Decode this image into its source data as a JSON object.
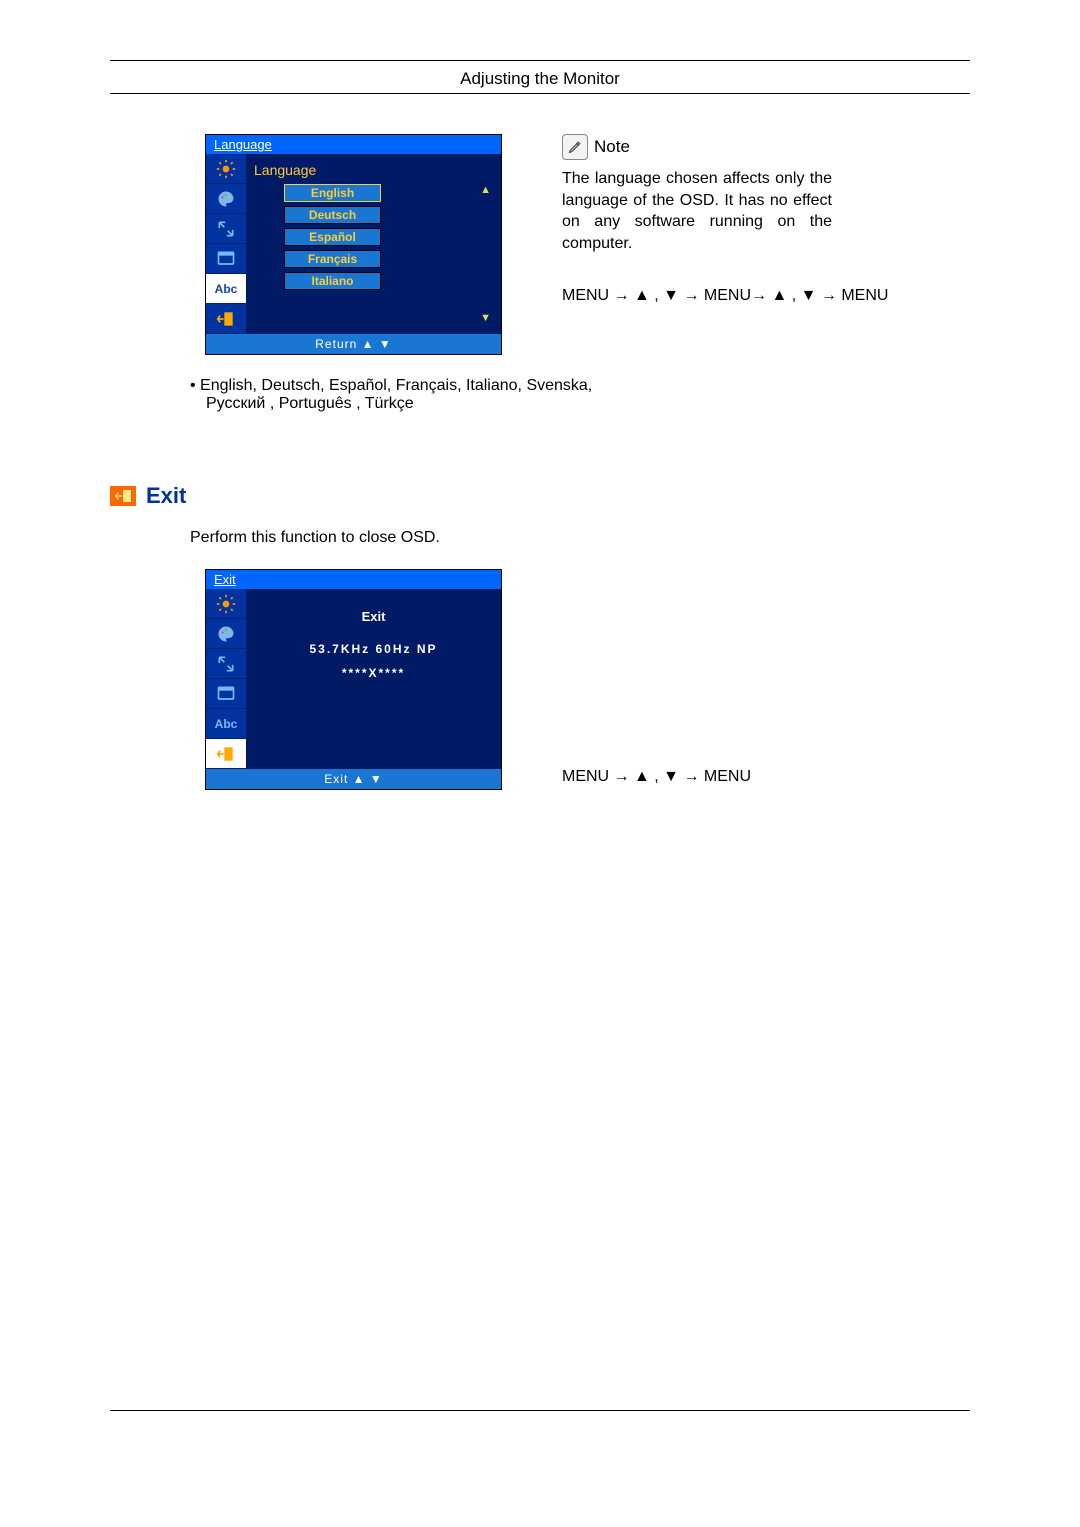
{
  "running_head": "Adjusting the Monitor",
  "osd1": {
    "title": "Language",
    "subtitle": "Language",
    "items": [
      "English",
      "Deutsch",
      "Español",
      "Français",
      "Italiano"
    ],
    "footer": "Return     ▲     ▼"
  },
  "note": {
    "label": "Note",
    "text": "The language chosen affects only the language of the OSD. It has no effect on any software running on the computer.",
    "nav": "MENU → ▲ , ▼ → MENU→ ▲ , ▼ → MENU"
  },
  "lang_all_line1": "• English, Deutsch, Español, Français,  Italiano, Svenska,",
  "lang_all_line2": "Русский , Português , Türkçe",
  "exit": {
    "heading": "Exit",
    "desc": "Perform this function to close OSD.",
    "osd_title": "Exit",
    "exit_label": "Exit",
    "info": "53.7KHz 60Hz NP",
    "stars": "****X****",
    "footer": "Exit       ▲     ▼",
    "nav": "MENU → ▲ , ▼ → MENU"
  }
}
